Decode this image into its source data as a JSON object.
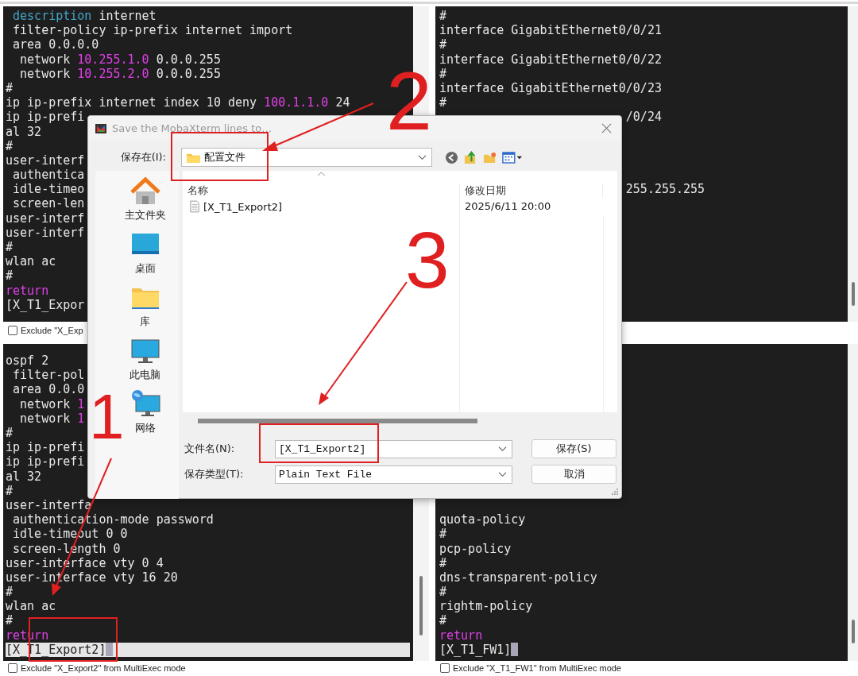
{
  "terminals": [
    {
      "lines": [
        {
          "kind": "code",
          "parts": [
            {
              "text": " description",
              "kind": "keyword"
            },
            {
              "text": " internet",
              "kind": "plain"
            }
          ]
        },
        {
          "kind": "code",
          "parts": [
            {
              "text": " filter-policy ip-prefix internet import",
              "kind": "plain"
            }
          ]
        },
        {
          "kind": "code",
          "parts": [
            {
              "text": " area 0.0.0.0",
              "kind": "plain"
            }
          ]
        },
        {
          "kind": "code",
          "parts": [
            {
              "text": "  network ",
              "kind": "plain"
            },
            {
              "text": "10.255.1.0",
              "kind": "address"
            },
            {
              "text": " 0.0.0.255",
              "kind": "plain"
            }
          ]
        },
        {
          "kind": "code",
          "parts": [
            {
              "text": "  network ",
              "kind": "plain"
            },
            {
              "text": "10.255.2.0",
              "kind": "address"
            },
            {
              "text": " 0.0.0.255",
              "kind": "plain"
            }
          ]
        },
        {
          "kind": "code",
          "parts": [
            {
              "text": "#",
              "kind": "plain"
            }
          ]
        },
        {
          "kind": "code",
          "parts": [
            {
              "text": "ip ip-prefix internet index 10 deny ",
              "kind": "plain"
            },
            {
              "text": "100.1.1.0",
              "kind": "address"
            },
            {
              "text": " 24",
              "kind": "plain"
            }
          ]
        },
        {
          "kind": "code",
          "parts": [
            {
              "text": "ip ip-prefi",
              "kind": "plain"
            }
          ]
        },
        {
          "kind": "code",
          "parts": [
            {
              "text": "al 32",
              "kind": "plain"
            }
          ]
        },
        {
          "kind": "code",
          "parts": [
            {
              "text": "#",
              "kind": "plain"
            }
          ]
        },
        {
          "kind": "code",
          "parts": [
            {
              "text": "user-interf",
              "kind": "plain"
            }
          ]
        },
        {
          "kind": "code",
          "parts": [
            {
              "text": " authentica",
              "kind": "plain"
            }
          ]
        },
        {
          "kind": "code",
          "parts": [
            {
              "text": " idle-timeo",
              "kind": "plain"
            }
          ]
        },
        {
          "kind": "code",
          "parts": [
            {
              "text": " screen-len",
              "kind": "plain"
            }
          ]
        },
        {
          "kind": "code",
          "parts": [
            {
              "text": "user-interf",
              "kind": "plain"
            }
          ]
        },
        {
          "kind": "code",
          "parts": [
            {
              "text": "user-interf",
              "kind": "plain"
            }
          ]
        },
        {
          "kind": "code",
          "parts": [
            {
              "text": "#",
              "kind": "plain"
            }
          ]
        },
        {
          "kind": "code",
          "parts": [
            {
              "text": "wlan ac",
              "kind": "plain"
            }
          ]
        },
        {
          "kind": "code",
          "parts": [
            {
              "text": "#",
              "kind": "plain"
            }
          ]
        },
        {
          "kind": "code",
          "parts": [
            {
              "text": "return",
              "kind": "keyword2"
            }
          ]
        },
        {
          "kind": "code",
          "parts": [
            {
              "text": "[X_T1_Expor",
              "kind": "plain"
            }
          ]
        }
      ],
      "checkbox": {
        "label": "Exclude \"X_Exp",
        "checked": false
      }
    },
    {
      "lines": [
        {
          "kind": "code",
          "parts": [
            {
              "text": "#",
              "kind": "plain"
            }
          ]
        },
        {
          "kind": "code",
          "parts": [
            {
              "text": "interface GigabitEthernet0/0/21",
              "kind": "plain"
            }
          ]
        },
        {
          "kind": "code",
          "parts": [
            {
              "text": "#",
              "kind": "plain"
            }
          ]
        },
        {
          "kind": "code",
          "parts": [
            {
              "text": "interface GigabitEthernet0/0/22",
              "kind": "plain"
            }
          ]
        },
        {
          "kind": "code",
          "parts": [
            {
              "text": "#",
              "kind": "plain"
            }
          ]
        },
        {
          "kind": "code",
          "parts": [
            {
              "text": "interface GigabitEthernet0/0/23",
              "kind": "plain"
            }
          ]
        },
        {
          "kind": "code",
          "parts": [
            {
              "text": "#",
              "kind": "plain"
            }
          ]
        },
        {
          "kind": "tail",
          "parts": [
            {
              "text": "/0/24",
              "kind": "plain"
            }
          ]
        },
        {
          "kind": "gap"
        },
        {
          "kind": "gap"
        },
        {
          "kind": "gap"
        },
        {
          "kind": "gap"
        },
        {
          "kind": "tail",
          "parts": [
            {
              "text": "255.255.255",
              "kind": "plain"
            }
          ]
        }
      ]
    },
    {
      "lines": [
        {
          "kind": "code",
          "parts": [
            {
              "text": "ospf 2",
              "kind": "plain"
            }
          ]
        },
        {
          "kind": "code",
          "parts": [
            {
              "text": " filter-pol",
              "kind": "plain"
            }
          ]
        },
        {
          "kind": "code",
          "parts": [
            {
              "text": " area 0.0.0",
              "kind": "plain"
            }
          ]
        },
        {
          "kind": "code",
          "parts": [
            {
              "text": "  network ",
              "kind": "plain"
            },
            {
              "text": "1",
              "kind": "address"
            }
          ]
        },
        {
          "kind": "code",
          "parts": [
            {
              "text": "  network ",
              "kind": "plain"
            },
            {
              "text": "1",
              "kind": "address"
            }
          ]
        },
        {
          "kind": "code",
          "parts": [
            {
              "text": "#",
              "kind": "plain"
            }
          ]
        },
        {
          "kind": "code",
          "parts": [
            {
              "text": "ip ip-prefi",
              "kind": "plain"
            }
          ]
        },
        {
          "kind": "code",
          "parts": [
            {
              "text": "ip ip-prefi",
              "kind": "plain"
            }
          ]
        },
        {
          "kind": "code",
          "parts": [
            {
              "text": "al 32",
              "kind": "plain"
            }
          ]
        },
        {
          "kind": "code",
          "parts": [
            {
              "text": "#",
              "kind": "plain"
            }
          ]
        },
        {
          "kind": "code",
          "parts": [
            {
              "text": "user-interfa",
              "kind": "plain"
            }
          ]
        },
        {
          "kind": "code",
          "parts": [
            {
              "text": " authentication-mode password",
              "kind": "plain"
            }
          ]
        },
        {
          "kind": "code",
          "parts": [
            {
              "text": " idle-timeout 0 0",
              "kind": "plain"
            }
          ]
        },
        {
          "kind": "code",
          "parts": [
            {
              "text": " screen-length 0",
              "kind": "plain"
            }
          ]
        },
        {
          "kind": "code",
          "parts": [
            {
              "text": "user-interface vty 0 4",
              "kind": "plain"
            }
          ]
        },
        {
          "kind": "code",
          "parts": [
            {
              "text": "user-interface vty 16 20",
              "kind": "plain"
            }
          ]
        },
        {
          "kind": "code",
          "parts": [
            {
              "text": "#",
              "kind": "plain"
            }
          ]
        },
        {
          "kind": "code",
          "parts": [
            {
              "text": "wlan ac",
              "kind": "plain"
            }
          ]
        },
        {
          "kind": "code",
          "parts": [
            {
              "text": "#",
              "kind": "plain"
            }
          ]
        },
        {
          "kind": "code",
          "parts": [
            {
              "text": "return",
              "kind": "keyword2"
            }
          ]
        },
        {
          "kind": "prompt",
          "highlighted": true,
          "cursor": true,
          "parts": [
            {
              "text": "[X_T1_Export2]",
              "kind": "plain"
            }
          ]
        }
      ],
      "checkbox": {
        "label": "Exclude \"X_Export2\" from MultiExec mode",
        "checked": false
      }
    },
    {
      "lines": [
        {
          "kind": "code",
          "parts": [
            {
              "text": "quota-policy",
              "kind": "plain"
            }
          ]
        },
        {
          "kind": "code",
          "parts": [
            {
              "text": "#",
              "kind": "plain"
            }
          ]
        },
        {
          "kind": "code",
          "parts": [
            {
              "text": "pcp-policy",
              "kind": "plain"
            }
          ]
        },
        {
          "kind": "code",
          "parts": [
            {
              "text": "#",
              "kind": "plain"
            }
          ]
        },
        {
          "kind": "code",
          "parts": [
            {
              "text": "dns-transparent-policy",
              "kind": "plain"
            }
          ]
        },
        {
          "kind": "code",
          "parts": [
            {
              "text": "#",
              "kind": "plain"
            }
          ]
        },
        {
          "kind": "code",
          "parts": [
            {
              "text": "rightm-policy",
              "kind": "plain"
            }
          ]
        },
        {
          "kind": "code",
          "parts": [
            {
              "text": "#",
              "kind": "plain"
            }
          ]
        },
        {
          "kind": "code",
          "parts": [
            {
              "text": "return",
              "kind": "keyword2"
            }
          ]
        },
        {
          "kind": "prompt",
          "highlighted": false,
          "cursor": true,
          "parts": [
            {
              "text": "[X_T1_FW1]",
              "kind": "plain"
            }
          ]
        }
      ],
      "checkbox": {
        "label": "Exclude \"X_T1_FW1\" from MultiExec mode",
        "checked": false
      }
    }
  ],
  "dialog": {
    "title": "Save the MobaXterm lines to…",
    "save_in": {
      "label": "保存在(I):",
      "value": "配置文件"
    },
    "places": [
      {
        "label": "主文件夹"
      },
      {
        "label": "桌面"
      },
      {
        "label": "库"
      },
      {
        "label": "此电脑"
      },
      {
        "label": "网络"
      }
    ],
    "columns": [
      "名称",
      "修改日期"
    ],
    "files": [
      {
        "name": "[X_T1_Export2]",
        "modified": "2025/6/11 20:00"
      }
    ],
    "file_name": {
      "label": "文件名(N):",
      "value": "[X_T1_Export2]"
    },
    "file_type": {
      "label": "保存类型(T):",
      "value": "Plain Text File"
    },
    "buttons": [
      "保存(S)",
      "取消"
    ]
  },
  "annotations": [
    {
      "label": "2"
    },
    {
      "label": "3"
    },
    {
      "label": "1"
    }
  ]
}
